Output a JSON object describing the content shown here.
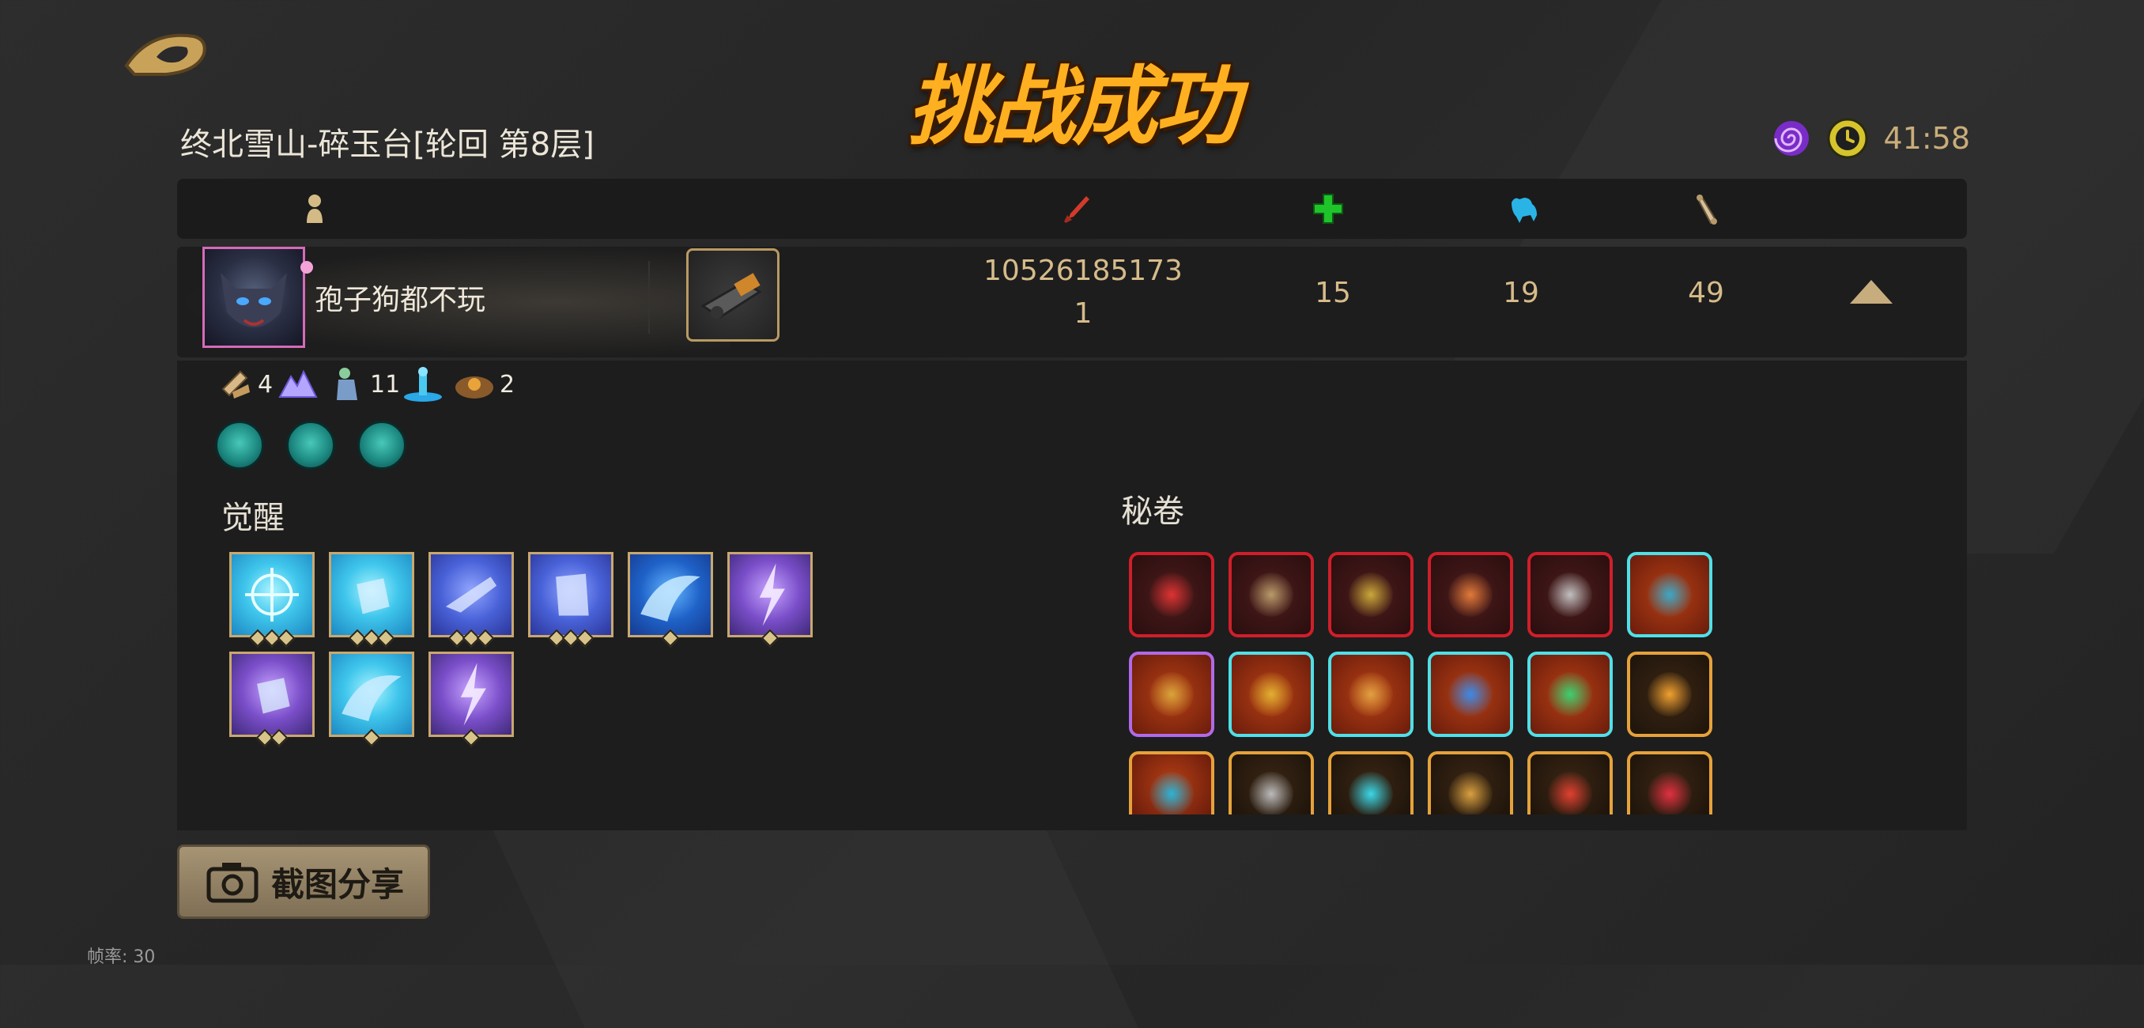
{
  "title": "挑战成功",
  "stage": "终北雪山-碎玉台[轮回  第8层]",
  "timer": "41:58",
  "header_icons": [
    "player-icon",
    "damage-icon",
    "heal-icon",
    "beast-icon",
    "scroll-icon"
  ],
  "player": {
    "name": "孢子狗都不玩",
    "damage_line1": "10526185173",
    "damage_line2": "1",
    "heal": "15",
    "stat3": "19",
    "stat4": "49"
  },
  "resources": [
    {
      "icon": "scroll-bundle-icon",
      "count": "4"
    },
    {
      "icon": "crystal-mountain-icon",
      "count": ""
    },
    {
      "icon": "statue-icon",
      "count": "11"
    },
    {
      "icon": "fountain-icon",
      "count": ""
    },
    {
      "icon": "treasure-icon",
      "count": "2"
    }
  ],
  "awakening": {
    "label": "觉醒",
    "pips": [
      3,
      3,
      3,
      3,
      1,
      1,
      2,
      1,
      1
    ]
  },
  "secret_scrolls": {
    "label": "秘卷"
  },
  "share_button": "截图分享",
  "fps": "帧率: 30"
}
